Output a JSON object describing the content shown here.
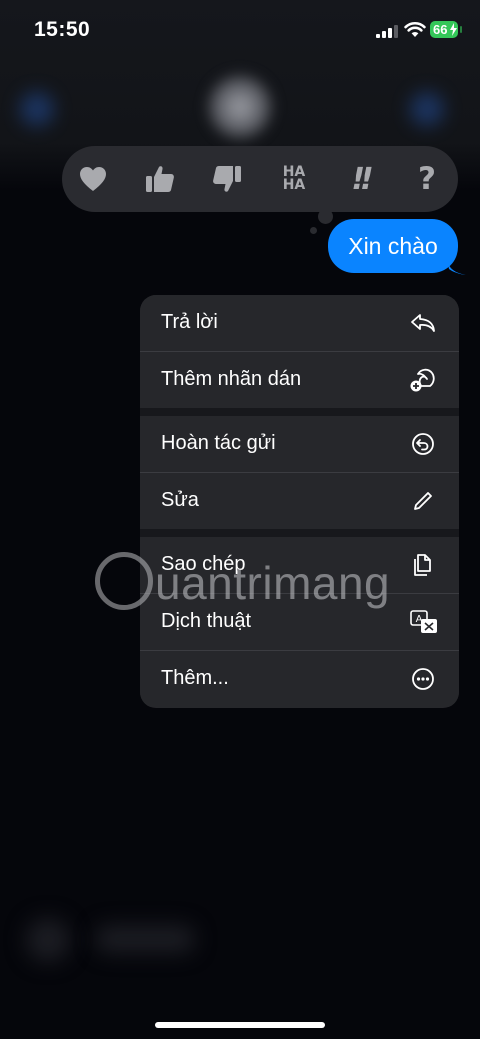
{
  "status_bar": {
    "time": "15:50",
    "battery": "66"
  },
  "reactions": [
    {
      "name": "heart"
    },
    {
      "name": "thumbs-up"
    },
    {
      "name": "thumbs-down"
    },
    {
      "name": "haha",
      "label": "HA HA"
    },
    {
      "name": "exclamation",
      "label": "!!"
    },
    {
      "name": "question",
      "label": "?"
    }
  ],
  "message": {
    "text": "Xin chào",
    "color": "#0a84ff"
  },
  "menu": {
    "items": [
      {
        "label": "Trả lời",
        "icon": "reply-icon"
      },
      {
        "label": "Thêm nhãn dán",
        "icon": "sticker-add-icon"
      },
      {
        "label": "Hoàn tác gửi",
        "icon": "undo-send-icon"
      },
      {
        "label": "Sửa",
        "icon": "pencil-icon"
      },
      {
        "label": "Sao chép",
        "icon": "copy-icon"
      },
      {
        "label": "Dịch thuật",
        "icon": "translate-icon"
      },
      {
        "label": "Thêm...",
        "icon": "more-icon"
      }
    ]
  },
  "watermark": {
    "text": "uantrimang"
  },
  "colors": {
    "accent": "#0a84ff",
    "battery": "#34c759",
    "menu_bg": "#26272b"
  }
}
